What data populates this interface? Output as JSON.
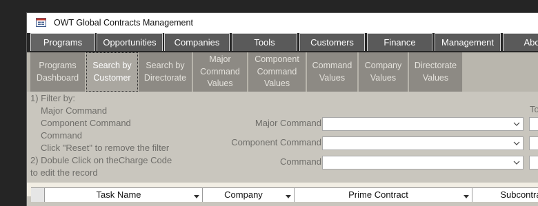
{
  "window": {
    "title": "OWT Global Contracts Management"
  },
  "top_tabs": [
    {
      "label": "Programs"
    },
    {
      "label": "Opportunities"
    },
    {
      "label": "Companies"
    },
    {
      "label": "Tools"
    },
    {
      "label": "Customers"
    },
    {
      "label": "Finance"
    },
    {
      "label": "Management"
    },
    {
      "label": "About"
    }
  ],
  "sub_tabs": [
    {
      "label": "Programs\nDashboard"
    },
    {
      "label": "Search by\nCustomer",
      "active": true
    },
    {
      "label": "Search by\nDirectorate"
    },
    {
      "label": "Major\nCommand\nValues"
    },
    {
      "label": "Component\nCommand\nValues"
    },
    {
      "label": "Command\nValues"
    },
    {
      "label": "Company\nValues"
    },
    {
      "label": "Directorate\nValues"
    }
  ],
  "instructions": {
    "line1": "1) Filter by:",
    "line2": "Major Command",
    "line3": "Component Command",
    "line4": "Command",
    "line5": "Click \"Reset\" to remove the filter",
    "line6": "2) Dobule Click on theCharge Code",
    "line7": "to edit the record"
  },
  "filters": {
    "major_command_label": "Major Command",
    "component_command_label": "Component Command",
    "command_label": "Command",
    "major_command_value": "",
    "component_command_value": "",
    "command_value": "",
    "right_label": "To"
  },
  "grid": {
    "columns": [
      "Task Name",
      "Company",
      "Prime Contract",
      "Subcontract"
    ]
  }
}
